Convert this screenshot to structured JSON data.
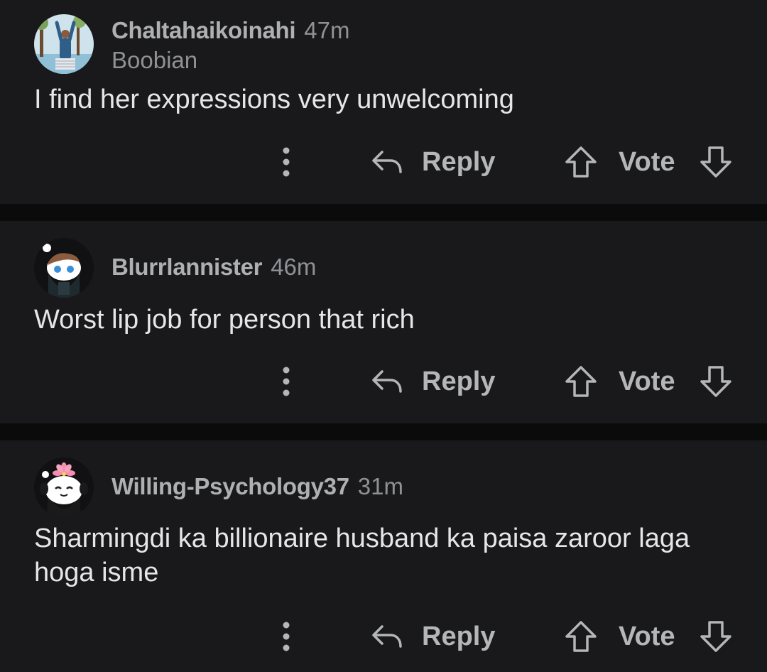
{
  "comments": [
    {
      "username": "Chaltahaikoinahi",
      "time": "47m",
      "flair": "Boobian",
      "body": "I find her expressions very unwelcoming",
      "avatar": "avatar-person-waving",
      "reply_label": "Reply",
      "vote_label": "Vote"
    },
    {
      "username": "Blurrlannister",
      "time": "46m",
      "body": "Worst lip job for person that rich",
      "avatar": "snoo-avatar",
      "reply_label": "Reply",
      "vote_label": "Vote"
    },
    {
      "username": "Willing-Psychology37",
      "time": "31m",
      "body": "Sharmingdi ka billionaire husband ka paisa zaroor laga hoga isme",
      "avatar": "snoo-flower-avatar",
      "reply_label": "Reply",
      "vote_label": "Vote"
    }
  ],
  "icons": {
    "more": "more-vertical-icon",
    "reply": "reply-arrow-icon",
    "upvote": "upvote-arrow-icon",
    "downvote": "downvote-arrow-icon"
  },
  "colors": {
    "page_background": "#0b0b0c",
    "card_background": "#19191b",
    "body_text": "#e6e6e8",
    "username": "#aeb0b4",
    "muted_text": "#8f9196",
    "action_text": "#b4b6ba"
  }
}
